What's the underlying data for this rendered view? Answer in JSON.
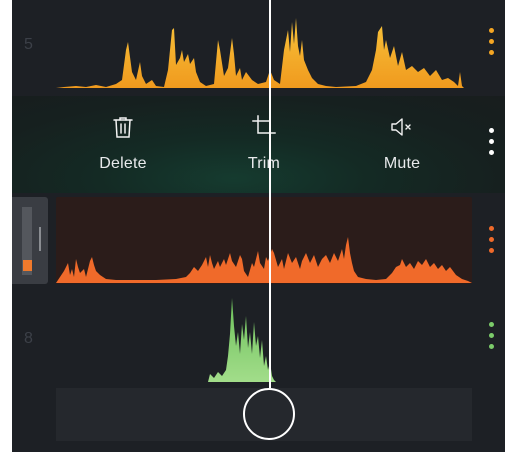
{
  "tracks": [
    {
      "number": "5",
      "color": "#f5a623"
    },
    {
      "number": "",
      "color": "#f06a2a"
    },
    {
      "number": "8",
      "color": "#7ccc6a"
    }
  ],
  "popup": {
    "actions": [
      {
        "label": "Delete",
        "icon": "trash-icon"
      },
      {
        "label": "Trim",
        "icon": "crop-icon"
      },
      {
        "label": "Mute",
        "icon": "speaker-mute-icon"
      }
    ]
  },
  "colors": {
    "background": "#1d2025",
    "track5": "#f5a623",
    "track7": "#f06a2a",
    "track8": "#7ccc6a",
    "playhead": "#ffffff"
  }
}
